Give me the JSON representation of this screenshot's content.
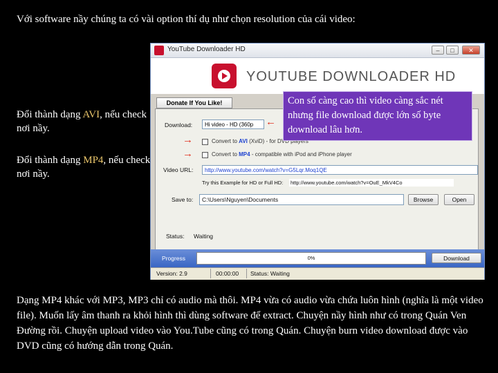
{
  "slide": {
    "heading": "Với software nầy chúng ta có vài option thí dụ như chọn resolution của cái video:",
    "note_avi": {
      "before": "Đổi thành dạng ",
      "format": "AVI",
      "after": ", nếu check nơi nầy."
    },
    "note_mp4": {
      "before": "Đổi thành dạng ",
      "format": "MP4",
      "after": ", nếu check nơi nầy."
    },
    "callout": "Con số càng cao thì video càng sắc nét nhưng file download được lớn số byte download lâu hơn.",
    "bottom_text": "Dạng MP4 khác với MP3, MP3 chỉ có audio mà thôi. MP4 vừa có audio vừa chứa luôn hình (nghĩa là một video file). Muốn lấy âm thanh ra khỏi hình thì dùng software để extract. Chuyện nầy hình như có trong Quán Ven Đường rồi. Chuyện upload video vào You.Tube cũng có trong Quán. Chuyện burn video download được vào DVD cũng có hướng dẫn trong Quán."
  },
  "app": {
    "window_title": "YouTube Downloader HD",
    "brand": "YOUTUBE DOWNLOADER HD",
    "donate_label": "Donate If You Like!",
    "download_label": "Download:",
    "download_select": "Hi video - HD (360p",
    "opt_avi": {
      "before": "Convert to ",
      "format": "AVI",
      "after": " (XviD) - for DVD players"
    },
    "opt_mp4": {
      "before": "Convert to ",
      "format": "MP4",
      "after": " - compatible with iPod and iPhone player"
    },
    "video_url_label": "Video URL:",
    "video_url": "http://www.youtube.com/watch?v=G5Lqr.Moq1QE",
    "hint_label": "Try this Example for HD or Full HD:",
    "hint_url": "http://www.youtube.com/watch?v=OuE_MkV4Co",
    "saveto_label": "Save to:",
    "saveto_path": "C:\\Users\\Nguyen\\Documents",
    "browse_label": "Browse",
    "open_label": "Open",
    "status_label": "Status:",
    "status_value": "Waiting",
    "progress_label": "Progress",
    "progress_percent": 0,
    "progress_text": "0%",
    "download_button": "Download",
    "version": "Version: 2.9",
    "time": "00:00:00",
    "statusbar_status": "Status: Waiting"
  },
  "colors": {
    "highlight": "#e8c46a",
    "callout_bg": "#6f36b8",
    "progress_fill": "#4fbf4f",
    "arrow": "#e0301e"
  }
}
